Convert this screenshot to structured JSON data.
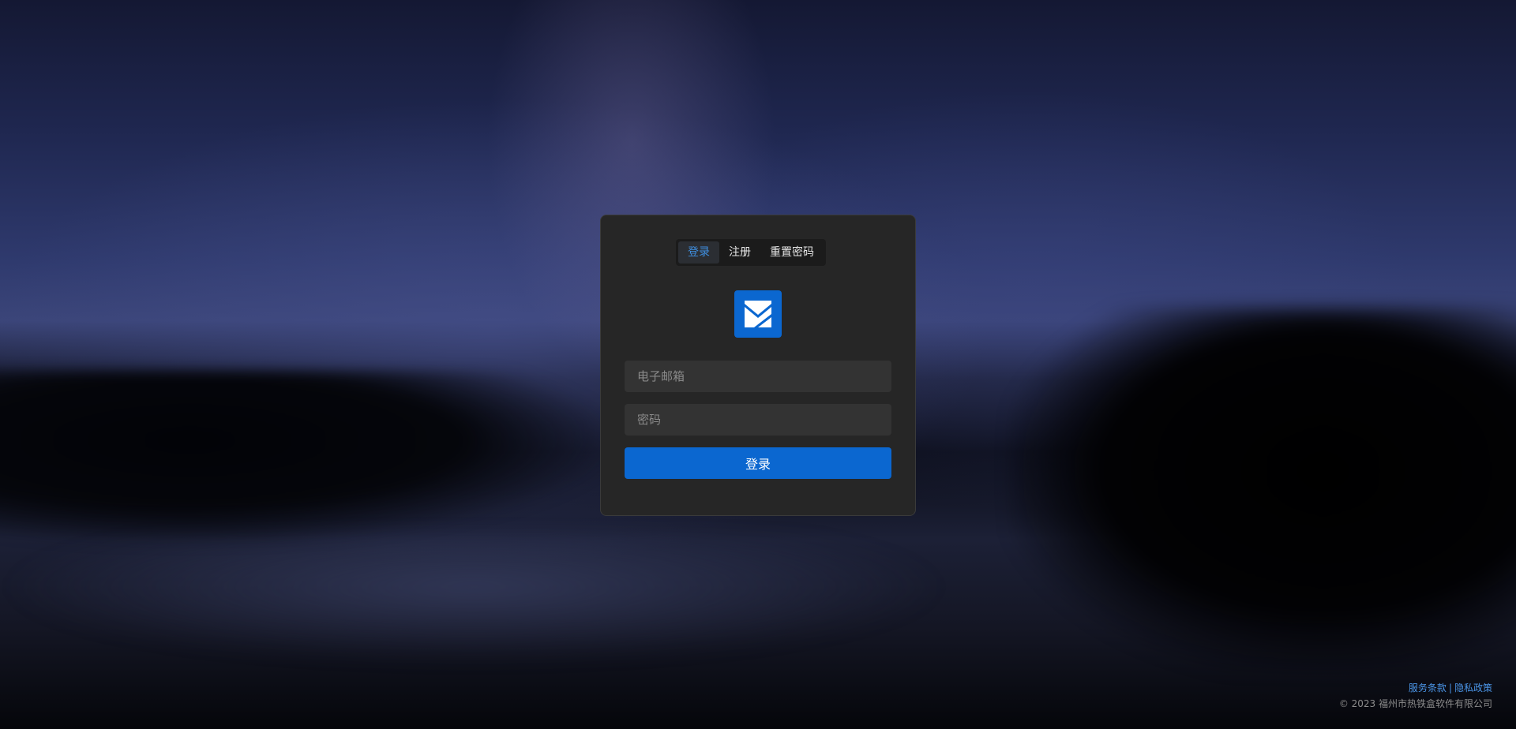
{
  "tabs": [
    {
      "label": "登录",
      "active": true
    },
    {
      "label": "注册",
      "active": false
    },
    {
      "label": "重置密码",
      "active": false
    }
  ],
  "logo": {
    "icon": "envelope-logo-icon",
    "color": "#0b67d0"
  },
  "form": {
    "email_placeholder": "电子邮箱",
    "email_value": "",
    "password_placeholder": "密码",
    "password_value": "",
    "submit_label": "登录"
  },
  "footer": {
    "terms_label": "服务条款",
    "separator": "|",
    "privacy_label": "隐私政策",
    "copyright": "© 2023 福州市热铁盒软件有限公司"
  },
  "colors": {
    "accent": "#0b67d0",
    "link": "#4a94e6",
    "card_bg": "#262626",
    "input_bg": "#333333"
  }
}
